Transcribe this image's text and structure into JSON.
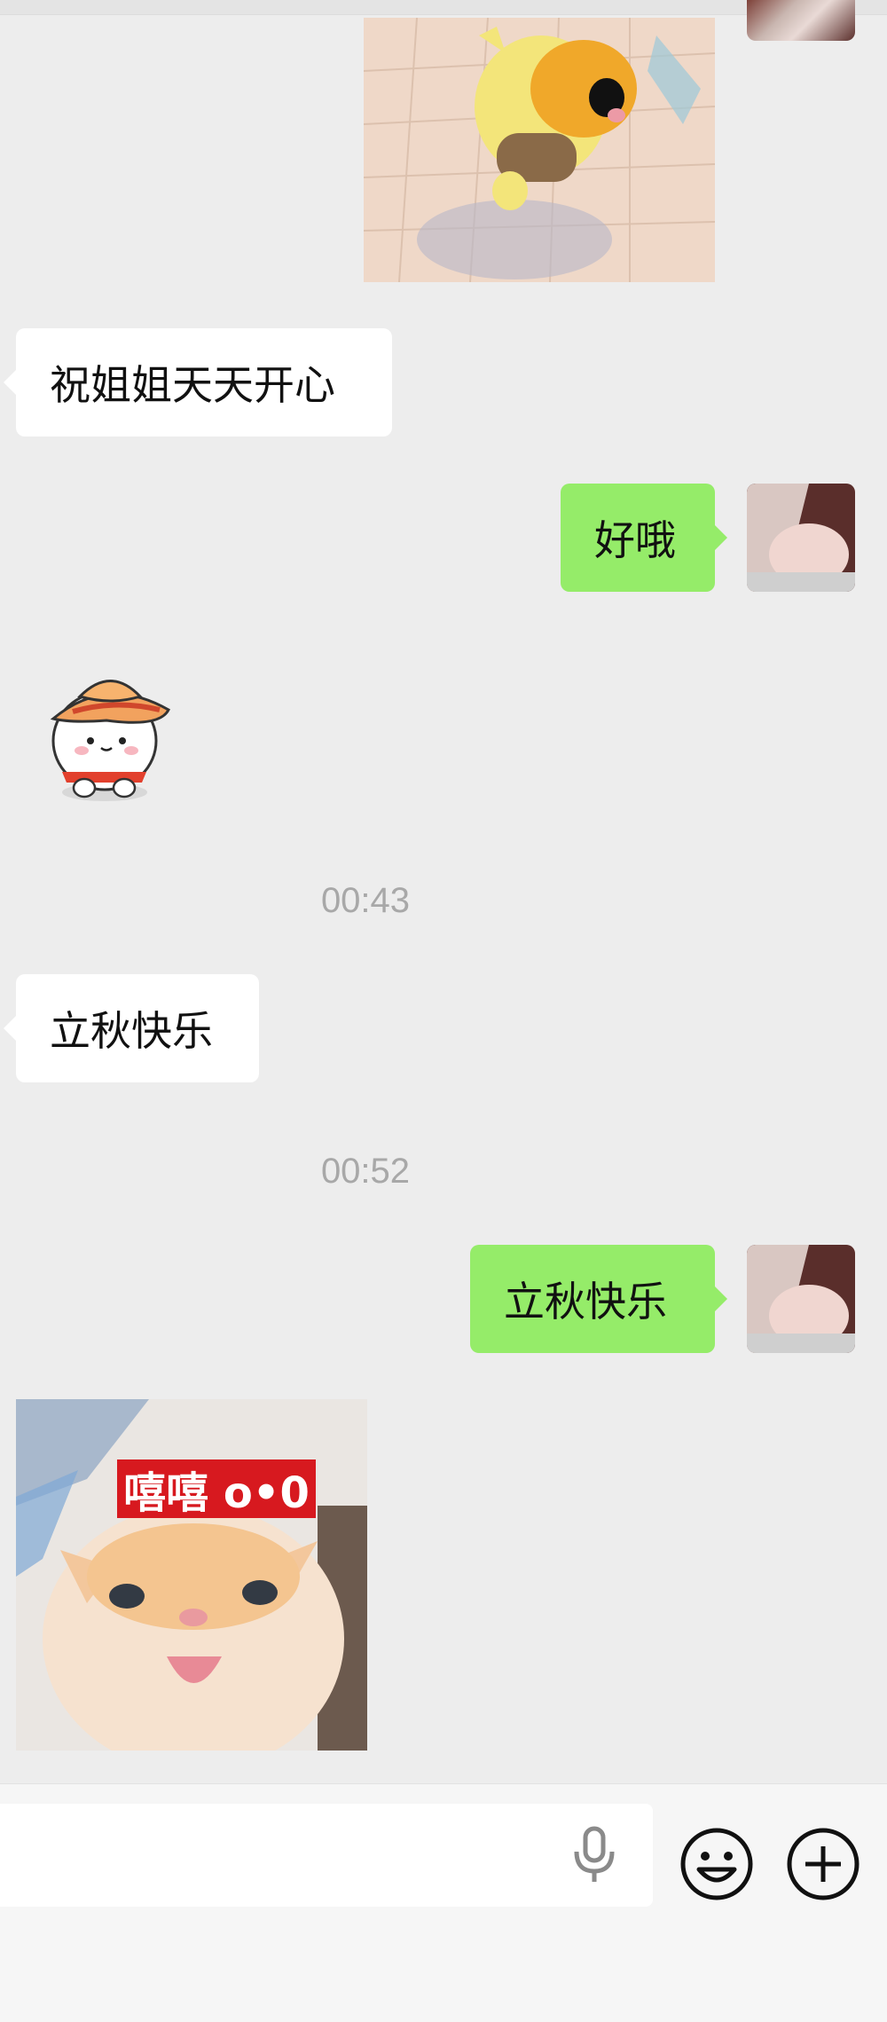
{
  "messages": {
    "greeting": "祝姐姐天天开心",
    "reply_ok": "好哦",
    "time_1": "00:43",
    "liqiu_in": "立秋快乐",
    "time_2": "00:52",
    "liqiu_out": "立秋快乐",
    "cat_caption": "嘻嘻 o•0"
  },
  "input": {
    "value": "",
    "placeholder": ""
  },
  "icons": {
    "voice": "microphone-icon",
    "emoji": "emoji-icon",
    "more": "plus-icon"
  },
  "colors": {
    "chat_bg": "#ededed",
    "bubble_out": "#95ec69",
    "bubble_in": "#ffffff",
    "timestamp": "#a8a8a8"
  }
}
